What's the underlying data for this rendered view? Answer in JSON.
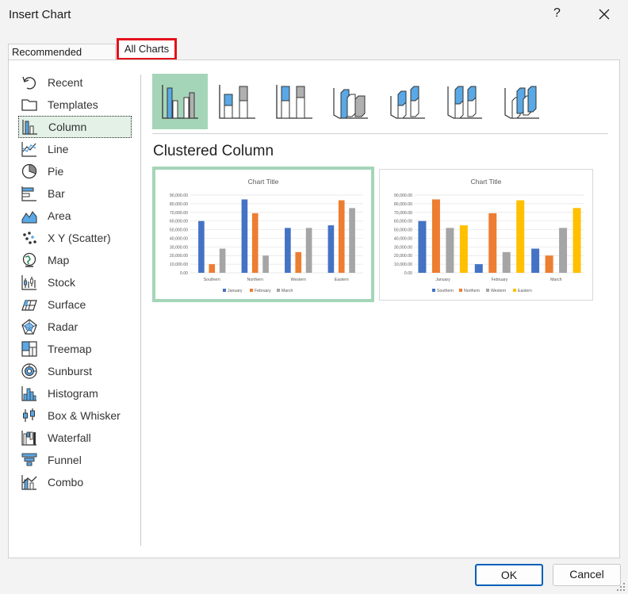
{
  "window": {
    "title": "Insert Chart",
    "help": "?"
  },
  "tabs": [
    {
      "label": "Recommended Charts"
    },
    {
      "label": "All Charts"
    }
  ],
  "sidebar": {
    "items": [
      {
        "label": "Recent",
        "icon": "undo-arrow-icon"
      },
      {
        "label": "Templates",
        "icon": "folder-icon"
      },
      {
        "label": "Column",
        "icon": "column-chart-icon"
      },
      {
        "label": "Line",
        "icon": "line-chart-icon"
      },
      {
        "label": "Pie",
        "icon": "pie-chart-icon"
      },
      {
        "label": "Bar",
        "icon": "bar-chart-icon"
      },
      {
        "label": "Area",
        "icon": "area-chart-icon"
      },
      {
        "label": "X Y (Scatter)",
        "icon": "scatter-chart-icon"
      },
      {
        "label": "Map",
        "icon": "map-globe-icon"
      },
      {
        "label": "Stock",
        "icon": "stock-chart-icon"
      },
      {
        "label": "Surface",
        "icon": "surface-chart-icon"
      },
      {
        "label": "Radar",
        "icon": "radar-chart-icon"
      },
      {
        "label": "Treemap",
        "icon": "treemap-chart-icon"
      },
      {
        "label": "Sunburst",
        "icon": "sunburst-chart-icon"
      },
      {
        "label": "Histogram",
        "icon": "histogram-chart-icon"
      },
      {
        "label": "Box & Whisker",
        "icon": "box-whisker-chart-icon"
      },
      {
        "label": "Waterfall",
        "icon": "waterfall-chart-icon"
      },
      {
        "label": "Funnel",
        "icon": "funnel-chart-icon"
      },
      {
        "label": "Combo",
        "icon": "combo-chart-icon"
      }
    ],
    "selected": "Column"
  },
  "subtype_name": "Clustered Column",
  "colors": {
    "blue": "#4472c4",
    "orange": "#ed7d31",
    "gray": "#a5a5a5",
    "yellow": "#ffc000",
    "selection": "#a5d5b8",
    "accent": "#005fb8",
    "highlight_red": "#e3121b"
  },
  "chart_data": [
    {
      "type": "bar",
      "title": "Chart Title",
      "categories": [
        "Southern",
        "Northern",
        "Western",
        "Eastern"
      ],
      "series": [
        {
          "name": "January",
          "values": [
            60000,
            85000,
            52000,
            55000
          ]
        },
        {
          "name": "February",
          "values": [
            10000,
            69000,
            24000,
            84000
          ]
        },
        {
          "name": "March",
          "values": [
            28000,
            20000,
            52000,
            75000
          ]
        }
      ],
      "ylim": [
        0,
        90000
      ],
      "yticks": [
        "0.00",
        "10,000.00",
        "20,000.00",
        "30,000.00",
        "40,000.00",
        "50,000.00",
        "60,000.00",
        "70,000.00",
        "80,000.00",
        "90,000.00"
      ],
      "legend": "bottom",
      "grid": true
    },
    {
      "type": "bar",
      "title": "Chart Title",
      "categories": [
        "January",
        "February",
        "March"
      ],
      "series": [
        {
          "name": "Southern",
          "values": [
            60000,
            10000,
            28000
          ]
        },
        {
          "name": "Northern",
          "values": [
            85000,
            69000,
            20000
          ]
        },
        {
          "name": "Western",
          "values": [
            52000,
            24000,
            52000
          ]
        },
        {
          "name": "Eastern",
          "values": [
            55000,
            84000,
            75000
          ]
        }
      ],
      "ylim": [
        0,
        90000
      ],
      "yticks": [
        "0.00",
        "10,000.00",
        "20,000.00",
        "30,000.00",
        "40,000.00",
        "50,000.00",
        "60,000.00",
        "70,000.00",
        "80,000.00",
        "90,000.00"
      ],
      "legend": "bottom",
      "grid": true
    }
  ],
  "buttons": {
    "ok": "OK",
    "cancel": "Cancel"
  }
}
